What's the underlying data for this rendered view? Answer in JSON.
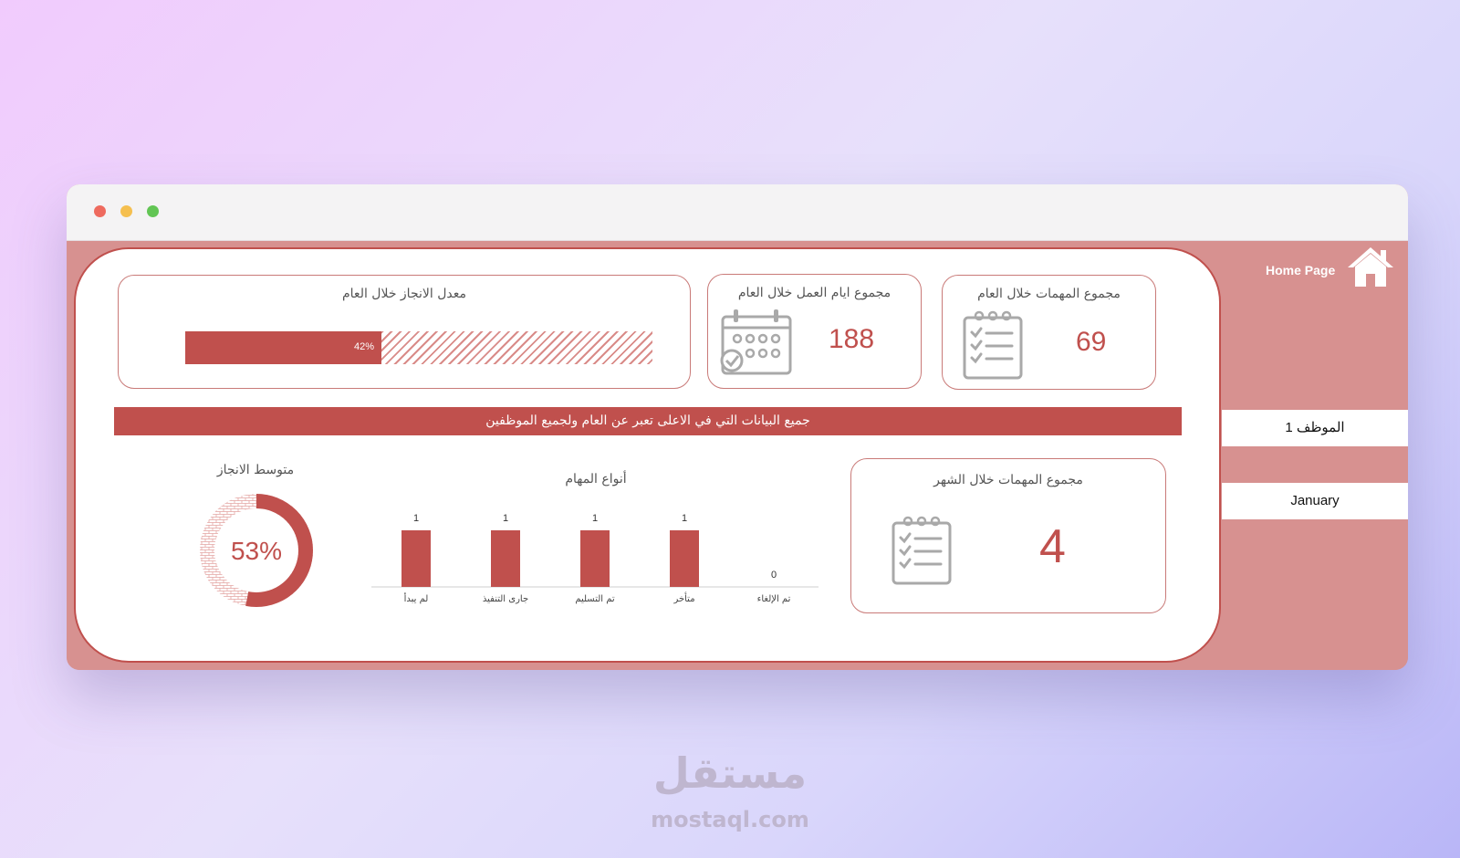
{
  "dashboard": {
    "annual_progress": {
      "title": "معدل الانجاز خلال العام",
      "percent": 42,
      "label": "42%"
    },
    "work_days": {
      "title": "مجموع ايام العمل خلال العام",
      "value": "188"
    },
    "annual_tasks": {
      "title": "مجموع المهمات خلال العام",
      "value": "69"
    },
    "banner": "جميع البيانات التي في الاعلى تعبر عن العام ولجميع الموظفين",
    "monthly_tasks": {
      "title": "مجموع المهمات خلال الشهر",
      "value": "4"
    },
    "avg_completion": {
      "title": "متوسط الانجاز",
      "percent": 53,
      "label": "53%"
    }
  },
  "chart_data": {
    "type": "bar",
    "title": "أنواع المهام",
    "categories": [
      "لم يبدأ",
      "جارى التنفيذ",
      "تم التسليم",
      "متأخر",
      "تم الإلغاء"
    ],
    "values": [
      1,
      1,
      1,
      1,
      0
    ],
    "ylim": [
      0,
      1
    ]
  },
  "sidebar": {
    "home_label": "Home Page",
    "employee": "الموظف 1",
    "month": "January"
  },
  "watermark": {
    "arabic": "مستقل",
    "latin": "mostaql.com"
  },
  "colors": {
    "accent": "#c0504d",
    "sidebar_bg": "#d79190"
  }
}
